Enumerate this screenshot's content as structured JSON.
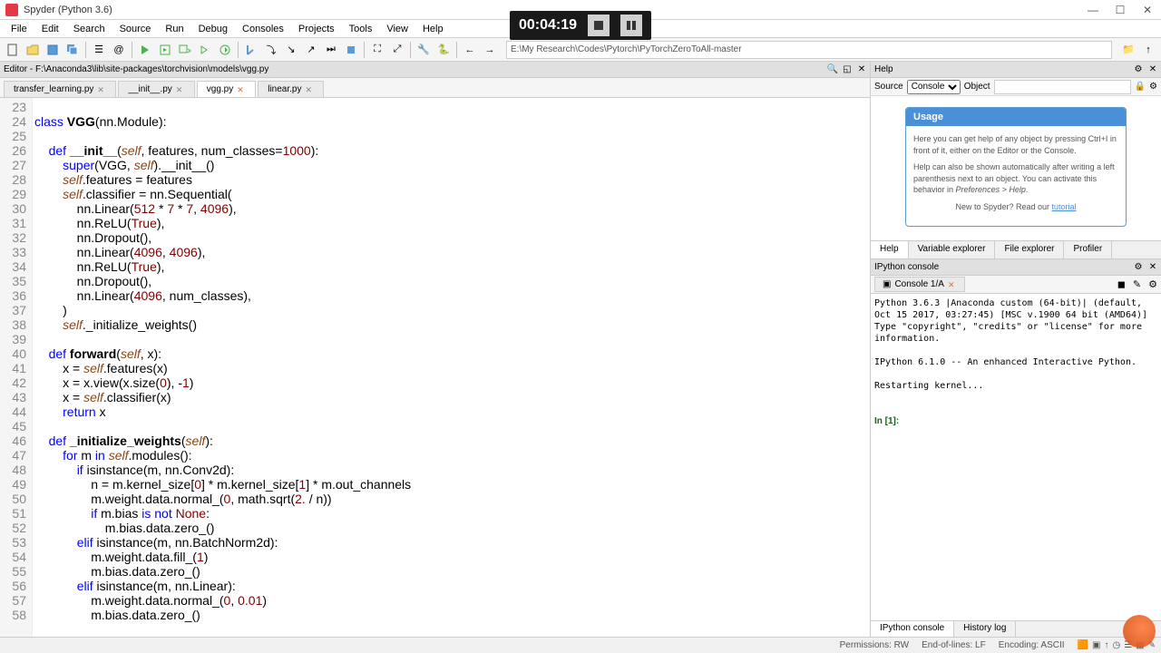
{
  "window": {
    "title": "Spyder (Python 3.6)"
  },
  "menu": [
    "File",
    "Edit",
    "Search",
    "Source",
    "Run",
    "Debug",
    "Consoles",
    "Projects",
    "Tools",
    "View",
    "Help"
  ],
  "video": {
    "time": "00:04:19"
  },
  "path": "E:\\My Research\\Codes\\Pytorch\\PyTorchZeroToAll-master",
  "editor": {
    "header": "Editor - F:\\Anaconda3\\lib\\site-packages\\torchvision\\models\\vgg.py",
    "tabs": [
      {
        "label": "transfer_learning.py",
        "active": false,
        "modified": false
      },
      {
        "label": "__init__.py",
        "active": false,
        "modified": false
      },
      {
        "label": "vgg.py",
        "active": true,
        "modified": true
      },
      {
        "label": "linear.py",
        "active": false,
        "modified": false
      }
    ],
    "line_start": 23,
    "line_end": 58
  },
  "help": {
    "header": "Help",
    "source_label": "Source",
    "source_value": "Console",
    "object_label": "Object",
    "usage_title": "Usage",
    "usage_para1": "Here you can get help of any object by pressing Ctrl+I in front of it, either on the Editor or the Console.",
    "usage_para2": "Help can also be shown automatically after writing a left parenthesis next to an object. You can activate this behavior in",
    "usage_prefs": "Preferences > Help",
    "new_text": "New to Spyder? Read our ",
    "tutorial": "tutorial",
    "tabs": [
      "Help",
      "Variable explorer",
      "File explorer",
      "Profiler"
    ]
  },
  "console": {
    "header": "IPython console",
    "tab": "Console 1/A",
    "lines": [
      "Python 3.6.3 |Anaconda custom (64-bit)| (default, Oct 15 2017, 03:27:45) [MSC v.1900 64 bit (AMD64)]",
      "Type \"copyright\", \"credits\" or \"license\" for more information.",
      "",
      "IPython 6.1.0 -- An enhanced Interactive Python.",
      "",
      "Restarting kernel...",
      ""
    ],
    "prompt": "In [1]:",
    "bottom_tabs": [
      "IPython console",
      "History log"
    ]
  },
  "status": {
    "permissions": "Permissions: RW",
    "eol": "End-of-lines: LF",
    "encoding": "Encoding: ASCII"
  }
}
